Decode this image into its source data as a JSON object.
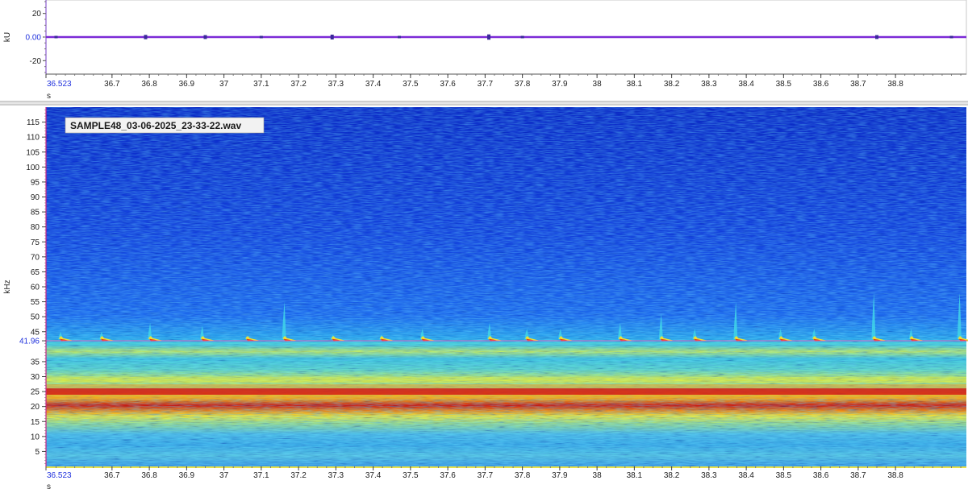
{
  "chart_data": [
    {
      "type": "line",
      "panel": "waveform",
      "ylabel": "kU",
      "xlabel": "s",
      "xlim": [
        36.523,
        38.99
      ],
      "ylim": [
        -30,
        30
      ],
      "y_ticks": [
        "20",
        "0.00",
        "-20"
      ],
      "y_tick_values": [
        20,
        0,
        -20
      ],
      "x_ticks": [
        "36.523",
        "36.7",
        "36.8",
        "36.9",
        "37",
        "37.1",
        "37.2",
        "37.3",
        "37.4",
        "37.5",
        "37.6",
        "37.7",
        "37.8",
        "37.9",
        "38",
        "38.1",
        "38.2",
        "38.3",
        "38.4",
        "38.5",
        "38.6",
        "38.7",
        "38.8"
      ],
      "x_tick_values": [
        36.523,
        36.7,
        36.8,
        36.9,
        37,
        37.1,
        37.2,
        37.3,
        37.4,
        37.5,
        37.6,
        37.7,
        37.8,
        37.9,
        38,
        38.1,
        38.2,
        38.3,
        38.4,
        38.5,
        38.6,
        38.7,
        38.8
      ],
      "series": [
        {
          "x": [
            36.55,
            36.79,
            36.95,
            37.1,
            37.29,
            37.47,
            37.71,
            37.8,
            38.75,
            38.95
          ],
          "y": [
            0,
            0.4,
            0.3,
            0,
            0.5,
            0,
            0.6,
            0,
            0.3,
            0
          ]
        }
      ],
      "line_color": "#7b2ad6"
    },
    {
      "type": "heatmap",
      "panel": "spectrogram",
      "title": "SAMPLE48_03-06-2025_23-33-22.wav",
      "ylabel": "kHz",
      "xlabel": "s",
      "xlim": [
        36.523,
        38.99
      ],
      "ylim": [
        0,
        120
      ],
      "y_ticks": [
        "115",
        "110",
        "105",
        "100",
        "95",
        "90",
        "85",
        "80",
        "75",
        "70",
        "65",
        "60",
        "55",
        "50",
        "45",
        "41.96",
        "35",
        "30",
        "25",
        "20",
        "15",
        "10",
        "5"
      ],
      "y_tick_values": [
        115,
        110,
        105,
        100,
        95,
        90,
        85,
        80,
        75,
        70,
        65,
        60,
        55,
        50,
        45,
        41.96,
        35,
        30,
        25,
        20,
        15,
        10,
        5
      ],
      "x_ticks": [
        "36.523",
        "36.7",
        "36.8",
        "36.9",
        "37",
        "37.1",
        "37.2",
        "37.3",
        "37.4",
        "37.5",
        "37.6",
        "37.7",
        "37.8",
        "37.9",
        "38",
        "38.1",
        "38.2",
        "38.3",
        "38.4",
        "38.5",
        "38.6",
        "38.7",
        "38.8"
      ],
      "x_tick_values": [
        36.523,
        36.7,
        36.8,
        36.9,
        37,
        37.1,
        37.2,
        37.3,
        37.4,
        37.5,
        37.6,
        37.7,
        37.8,
        37.9,
        38,
        38.1,
        38.2,
        38.3,
        38.4,
        38.5,
        38.6,
        38.7,
        38.8
      ],
      "cursor_frequency_khz": 41.96,
      "noise_band_khz": 25,
      "colormap": [
        "#0a1a8c",
        "#1e6cf0",
        "#2fc8e8",
        "#f4ef2a",
        "#f07a12",
        "#c81010"
      ],
      "call_times_s": [
        36.56,
        36.67,
        36.8,
        36.94,
        37.06,
        37.16,
        37.29,
        37.42,
        37.53,
        37.71,
        37.81,
        37.9,
        38.06,
        38.17,
        38.26,
        38.37,
        38.49,
        38.58,
        38.74,
        38.84,
        38.97
      ],
      "call_peak_khz": [
        45,
        45,
        48,
        47,
        43,
        55,
        44,
        44,
        46,
        48,
        46,
        46,
        48,
        51,
        46,
        55,
        46,
        46,
        58,
        46,
        58
      ]
    }
  ]
}
